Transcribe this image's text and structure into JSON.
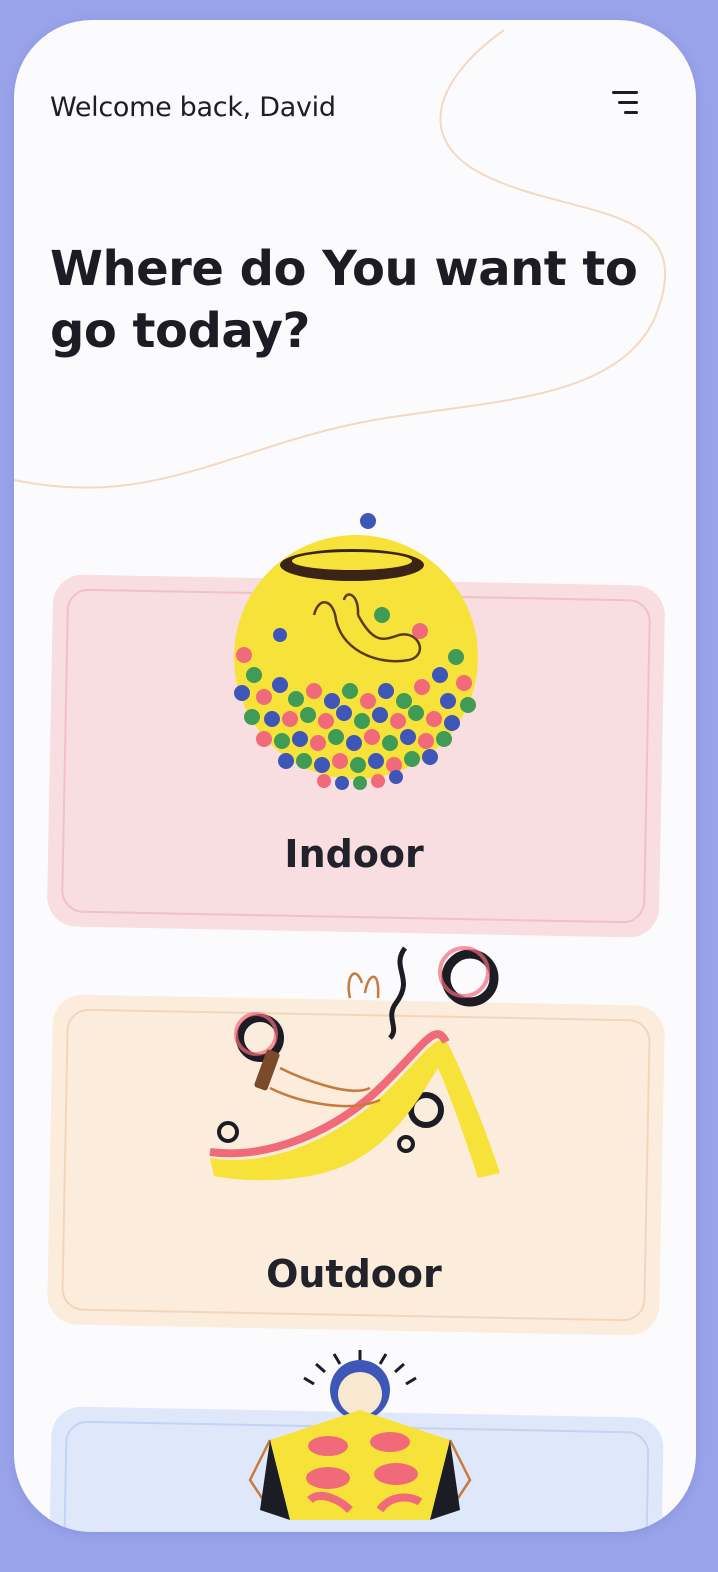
{
  "header": {
    "greeting": "Welcome back, David",
    "menu_icon": "hamburger-menu-icon"
  },
  "headline": "Where do You want to go today?",
  "categories": [
    {
      "label": "Indoor",
      "bg_color": "#f8dde1",
      "icon": "ball-pit-illustration"
    },
    {
      "label": "Outdoor",
      "bg_color": "#fcecdc",
      "icon": "slide-illustration"
    },
    {
      "label": "",
      "bg_color": "#dfe8fb",
      "icon": "lego-brick-illustration"
    }
  ],
  "colors": {
    "frame": "#98a3ea",
    "screen": "#fbfbfd",
    "text": "#1c1c24",
    "accent_yellow": "#f7e23a",
    "accent_pink": "#f06a7a",
    "accent_blue": "#3e56b8",
    "accent_green": "#3f9b55"
  }
}
